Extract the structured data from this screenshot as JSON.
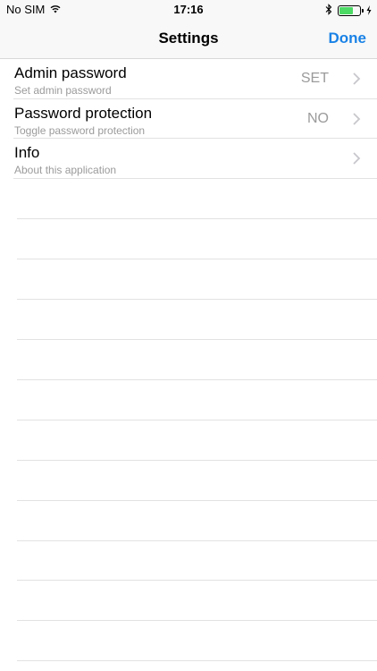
{
  "status_bar": {
    "carrier": "No SIM",
    "time": "17:16",
    "wifi_icon": "wifi-icon",
    "bluetooth_icon": "bluetooth-icon",
    "battery_icon": "battery-icon",
    "charging_icon": "charging-bolt-icon",
    "battery_level": 0.7
  },
  "nav": {
    "title": "Settings",
    "done_label": "Done"
  },
  "settings": [
    {
      "title": "Admin password",
      "subtitle": "Set admin password",
      "value": "SET"
    },
    {
      "title": "Password protection",
      "subtitle": "Toggle password protection",
      "value": "NO"
    },
    {
      "title": "Info",
      "subtitle": "About this application",
      "value": ""
    }
  ],
  "colors": {
    "accent": "#1a82e6",
    "secondary_text": "#9b9b9b",
    "separator": "#e2e2e2",
    "battery": "#4cd964"
  }
}
